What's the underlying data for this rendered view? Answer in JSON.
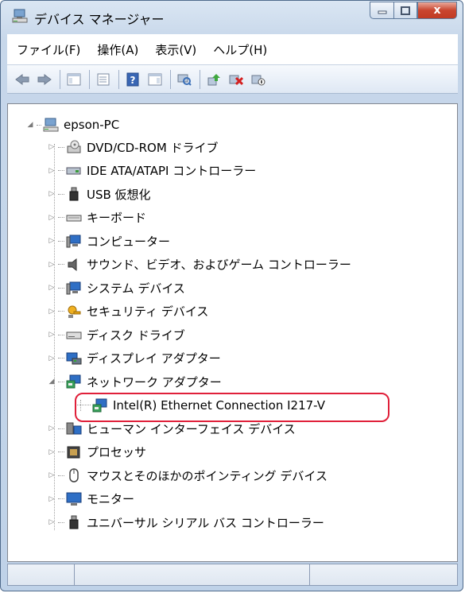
{
  "window": {
    "title": "デバイス マネージャー",
    "close_label": "x"
  },
  "menu": [
    {
      "label": "ファイル(F)"
    },
    {
      "label": "操作(A)"
    },
    {
      "label": "表示(V)"
    },
    {
      "label": "ヘルプ(H)"
    }
  ],
  "tree": {
    "root": "epson-PC",
    "items": [
      {
        "label": "DVD/CD-ROM ドライブ",
        "icon": "dvd-drive-icon",
        "expander": "collapsed"
      },
      {
        "label": "IDE ATA/ATAPI コントローラー",
        "icon": "ide-controller-icon",
        "expander": "collapsed"
      },
      {
        "label": "USB 仮想化",
        "icon": "usb-icon",
        "expander": "collapsed"
      },
      {
        "label": "キーボード",
        "icon": "keyboard-icon",
        "expander": "collapsed"
      },
      {
        "label": "コンピューター",
        "icon": "computer-icon",
        "expander": "collapsed"
      },
      {
        "label": "サウンド、ビデオ、およびゲーム コントローラー",
        "icon": "speaker-icon",
        "expander": "collapsed"
      },
      {
        "label": "システム デバイス",
        "icon": "system-device-icon",
        "expander": "collapsed"
      },
      {
        "label": "セキュリティ デバイス",
        "icon": "security-key-icon",
        "expander": "collapsed"
      },
      {
        "label": "ディスク ドライブ",
        "icon": "disk-drive-icon",
        "expander": "collapsed"
      },
      {
        "label": "ディスプレイ アダプター",
        "icon": "display-adapter-icon",
        "expander": "collapsed"
      },
      {
        "label": "ネットワーク アダプター",
        "icon": "network-adapter-icon",
        "expander": "expanded"
      },
      {
        "label": "Intel(R) Ethernet Connection I217-V",
        "icon": "network-adapter-icon",
        "expander": "none"
      },
      {
        "label": "ヒューマン インターフェイス デバイス",
        "icon": "hid-icon",
        "expander": "collapsed"
      },
      {
        "label": "プロセッサ",
        "icon": "processor-icon",
        "expander": "collapsed"
      },
      {
        "label": "マウスとそのほかのポインティング デバイス",
        "icon": "mouse-icon",
        "expander": "collapsed"
      },
      {
        "label": "モニター",
        "icon": "monitor-icon",
        "expander": "collapsed"
      },
      {
        "label": "ユニバーサル シリアル バス コントローラー",
        "icon": "usb-icon",
        "expander": "collapsed"
      }
    ]
  }
}
